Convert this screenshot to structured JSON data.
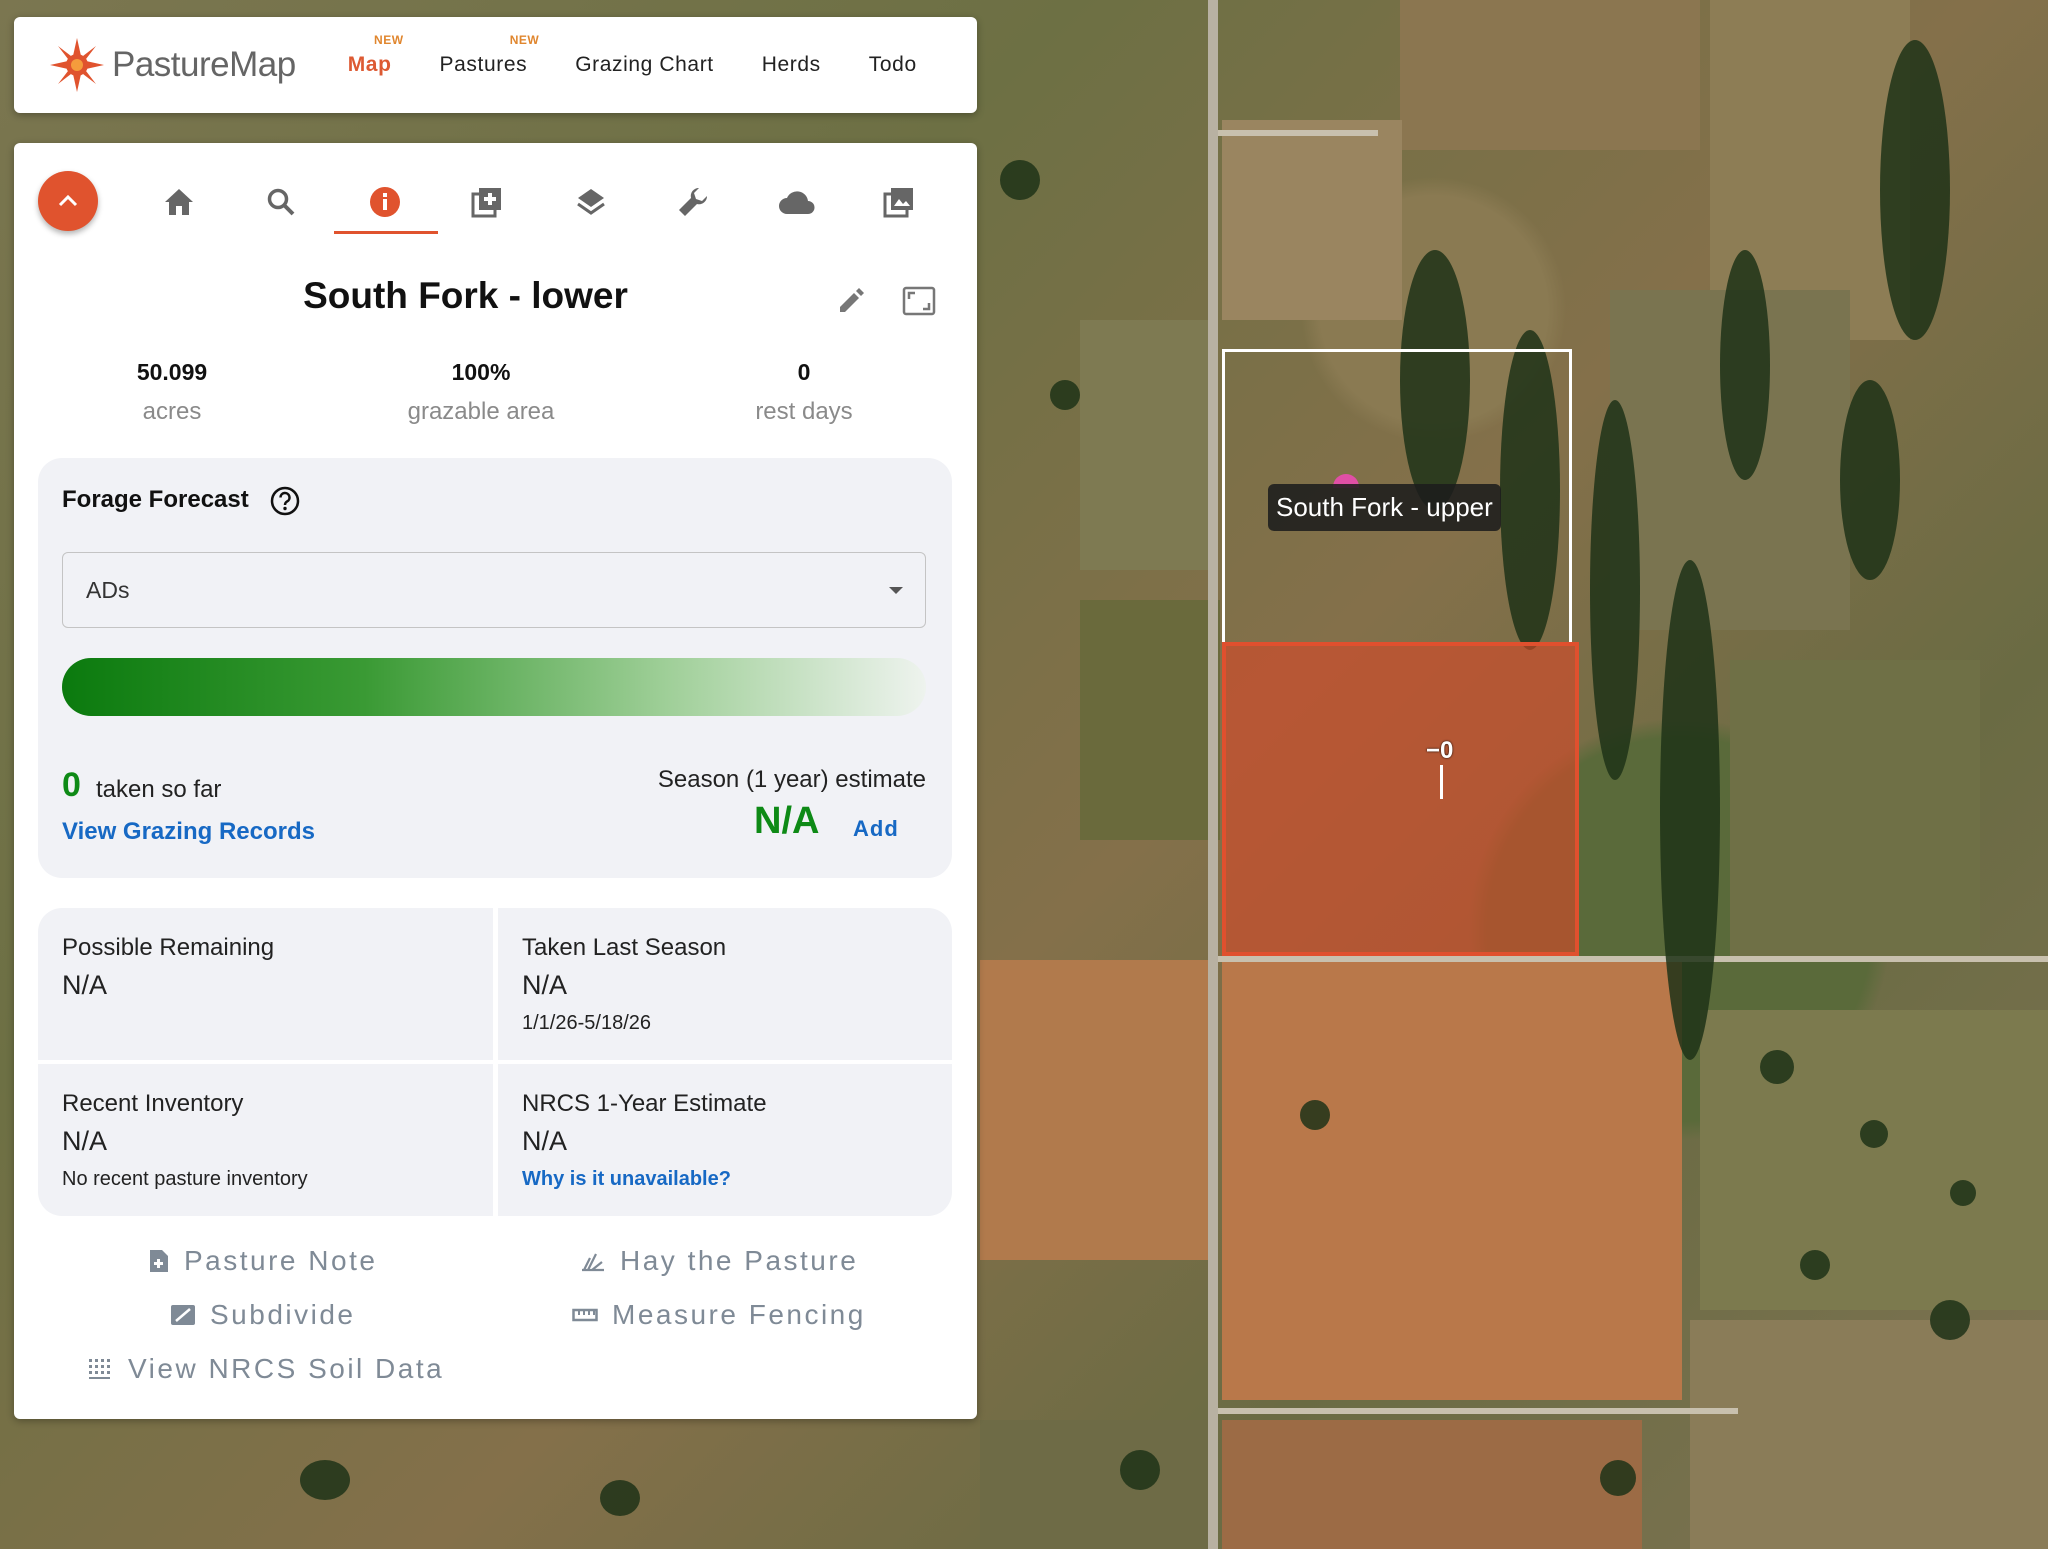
{
  "app": {
    "name": "PastureMap"
  },
  "nav": {
    "items": [
      {
        "label": "Map",
        "badge": "NEW",
        "active": true
      },
      {
        "label": "Pastures",
        "badge": "NEW",
        "active": false
      },
      {
        "label": "Grazing Chart",
        "badge": "",
        "active": false
      },
      {
        "label": "Herds",
        "badge": "",
        "active": false
      },
      {
        "label": "Todo",
        "badge": "",
        "active": false
      }
    ]
  },
  "toolbar": {
    "tabs": [
      "home-icon",
      "search-icon",
      "info-icon",
      "add-layer-icon",
      "layers-icon",
      "wrench-icon",
      "cloud-icon",
      "photos-icon"
    ],
    "active_tab": "info-icon"
  },
  "pasture": {
    "title": "South Fork - lower",
    "stats": [
      {
        "value": "50.099",
        "label": "acres"
      },
      {
        "value": "100%",
        "label": "grazable area"
      },
      {
        "value": "0",
        "label": "rest days"
      }
    ]
  },
  "forecast": {
    "title": "Forage Forecast",
    "unit_selected": "ADs",
    "taken_value": "0",
    "taken_label": "taken so far",
    "records_link": "View Grazing Records",
    "season_label": "Season (1 year) estimate",
    "season_value": "N/A",
    "add_label": "Add",
    "bar_fill": 1.0
  },
  "info": {
    "possible_remaining": {
      "label": "Possible Remaining",
      "value": "N/A"
    },
    "taken_last_season": {
      "label": "Taken Last Season",
      "value": "N/A",
      "range": "1/1/26-5/18/26"
    },
    "recent_inventory": {
      "label": "Recent Inventory",
      "value": "N/A",
      "note": "No recent pasture inventory"
    },
    "nrcs_estimate": {
      "label": "NRCS 1-Year Estimate",
      "value": "N/A",
      "link": "Why is it unavailable?"
    }
  },
  "actions": {
    "pasture_note": "Pasture Note",
    "hay_pasture": "Hay the Pasture",
    "subdivide": "Subdivide",
    "measure_fencing": "Measure Fencing",
    "nrcs_soil": "View NRCS Soil Data"
  },
  "map": {
    "upper_label": "South Fork - upper",
    "lower_marker": "0",
    "colors": {
      "lower_fill": "#d64828",
      "upper_outline": "#ffffff"
    }
  },
  "colors": {
    "accent": "#e0532e",
    "green": "#0e8a16",
    "link": "#1769c4"
  }
}
